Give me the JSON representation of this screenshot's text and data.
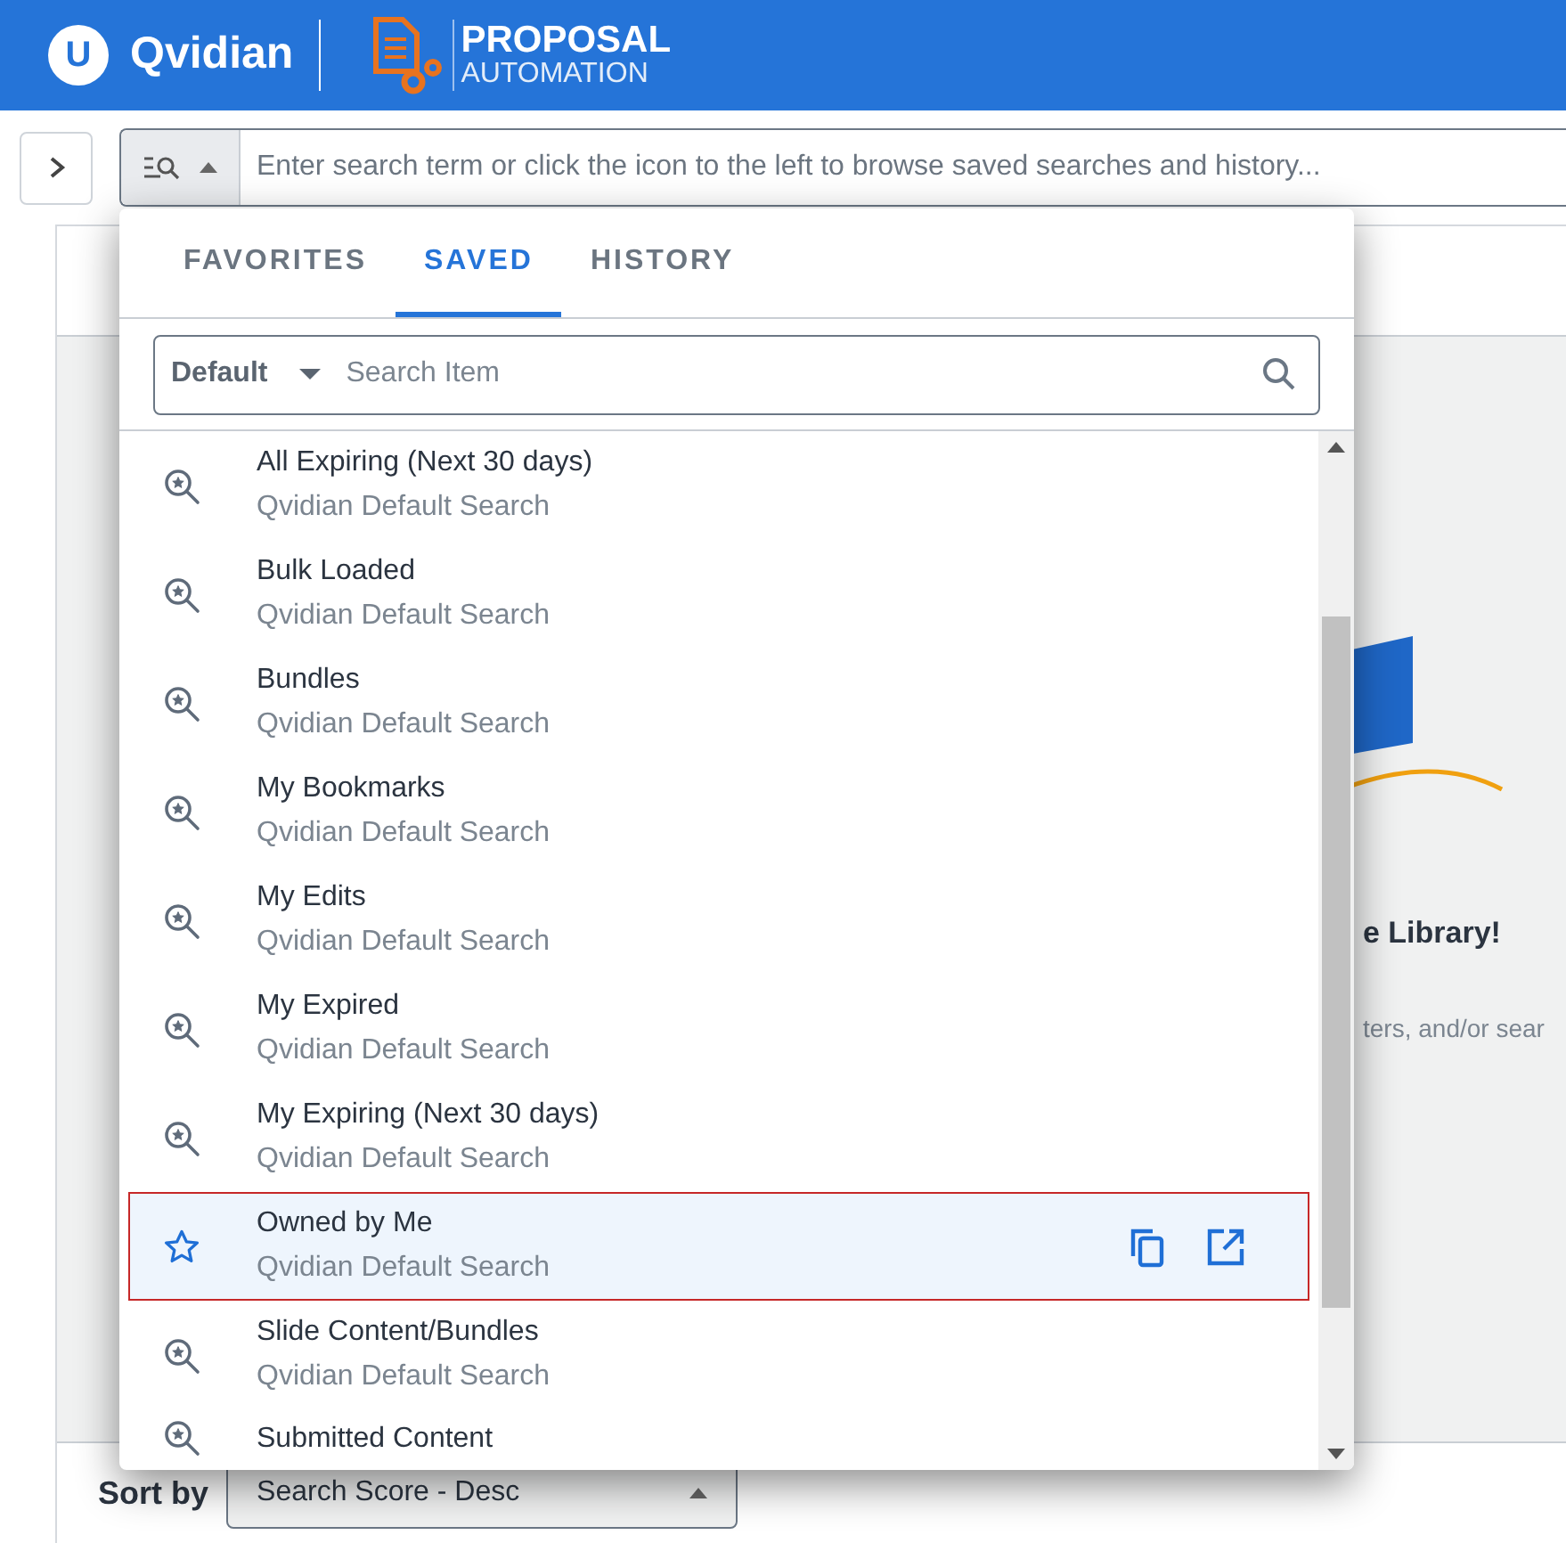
{
  "header": {
    "brand": "Qvidian",
    "brand_mark": "U",
    "product_line1": "PROPOSAL",
    "product_line2": "AUTOMATION"
  },
  "search_bar": {
    "browse_open": true,
    "placeholder": "Enter search term or click the icon to the left to browse saved searches and history..."
  },
  "background": {
    "heading": "e Library!",
    "hint": "ters, and/or sear"
  },
  "popup": {
    "tabs": [
      {
        "label": "FAVORITES",
        "selected": false
      },
      {
        "label": "SAVED",
        "selected": true
      },
      {
        "label": "HISTORY",
        "selected": false
      }
    ],
    "filter": {
      "scope": "Default",
      "placeholder": "Search Item"
    },
    "items": [
      {
        "title": "All Expiring (Next 30 days)",
        "subtitle": "Qvidian Default Search",
        "selected": false
      },
      {
        "title": "Bulk Loaded",
        "subtitle": "Qvidian Default Search",
        "selected": false
      },
      {
        "title": "Bundles",
        "subtitle": "Qvidian Default Search",
        "selected": false
      },
      {
        "title": "My Bookmarks",
        "subtitle": "Qvidian Default Search",
        "selected": false
      },
      {
        "title": "My Edits",
        "subtitle": "Qvidian Default Search",
        "selected": false
      },
      {
        "title": "My Expired",
        "subtitle": "Qvidian Default Search",
        "selected": false
      },
      {
        "title": "My Expiring (Next 30 days)",
        "subtitle": "Qvidian Default Search",
        "selected": false
      },
      {
        "title": "Owned by Me",
        "subtitle": "Qvidian Default Search",
        "selected": true
      },
      {
        "title": "Slide Content/Bundles",
        "subtitle": "Qvidian Default Search",
        "selected": false
      },
      {
        "title": "Submitted Content",
        "selected": false
      }
    ]
  },
  "sort": {
    "label": "Sort by",
    "value": "Search Score - Desc"
  }
}
